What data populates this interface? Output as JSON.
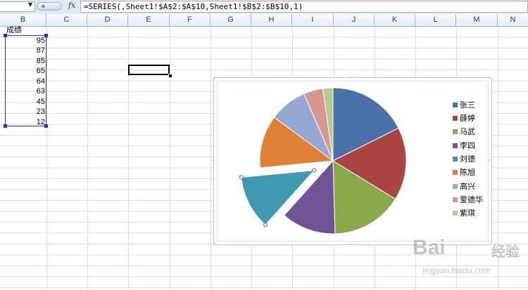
{
  "formula_bar": {
    "name_box_arrow": "▼",
    "fx_icon": "fx",
    "formula": "=SERIES(,Sheet1!$A$2:$A$10,Sheet1!$B$2:$B$10,1)"
  },
  "columns": [
    "B",
    "C",
    "D",
    "E",
    "F",
    "G",
    "H",
    "I",
    "J",
    "K",
    "L",
    "M",
    "N"
  ],
  "sheet": {
    "header_cell": "成绩",
    "values": [
      "95",
      "87",
      "85",
      "65",
      "64",
      "63",
      "45",
      "23",
      "12"
    ]
  },
  "chart_data": {
    "type": "pie",
    "categories": [
      "张三",
      "薛婷",
      "马武",
      "李四",
      "刘德",
      "陈旭",
      "高兴",
      "爱德华",
      "紫琪"
    ],
    "values": [
      95,
      87,
      85,
      65,
      64,
      63,
      45,
      23,
      12
    ],
    "exploded_index": 4,
    "selected_index": 4,
    "colors": [
      "#4a72a8",
      "#a94442",
      "#8aa84a",
      "#6e5494",
      "#3f9ab1",
      "#dd8136",
      "#94a9d2",
      "#d89693",
      "#b6cc8e"
    ],
    "legend_position": "right",
    "title": ""
  },
  "watermark": {
    "logo": "Bai",
    "paw": "",
    "du": "",
    "jingyan": "经验",
    "url": "jingyan.baidu.com"
  }
}
